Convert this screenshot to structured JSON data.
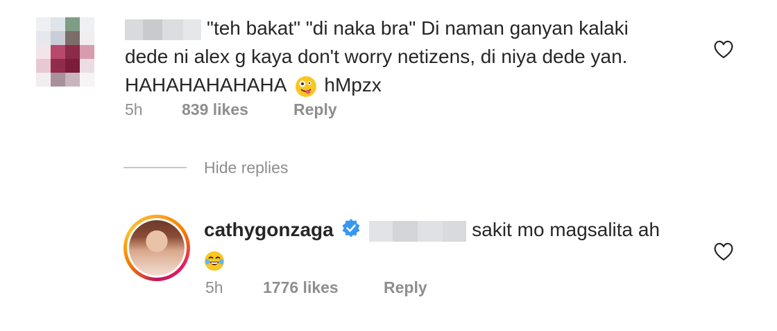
{
  "comment1": {
    "text_line1": "\"teh bakat\" \"di naka bra\" Di naman ganyan kalaki",
    "text_line2": "dede ni alex g kaya don't worry netizens, di niya dede yan.",
    "text_line3": "HAHAHAHAHAHA",
    "text_after_emoji": "hMpzx",
    "emoji": "zany-face-emoji",
    "time": "5h",
    "likes": "839 likes",
    "reply_label": "Reply"
  },
  "hide_replies_label": "Hide replies",
  "reply1": {
    "username": "cathygonzaga",
    "text": "sakit mo magsalita ah",
    "emoji": "tears-of-joy-emoji",
    "time": "5h",
    "likes": "1776 likes",
    "reply_label": "Reply"
  },
  "colors": {
    "text": "#262626",
    "meta": "#8e8e8e",
    "verified": "#3897f0",
    "divider": "#c7c7c7"
  }
}
